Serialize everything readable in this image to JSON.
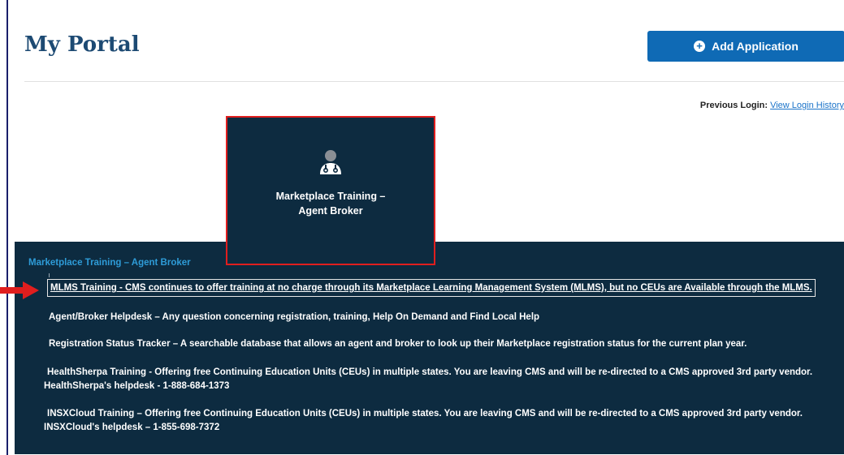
{
  "header": {
    "title": "My Portal",
    "add_application_label": "Add Application",
    "previous_login_label": "Previous Login:",
    "view_login_history": "View Login History"
  },
  "tile": {
    "label_line1": "Marketplace Training –",
    "label_line2": "Agent Broker",
    "icon": "person-stethoscope-icon"
  },
  "panel": {
    "heading": "Marketplace Training – Agent Broker",
    "items": [
      {
        "text": "MLMS Training - CMS continues to offer training at no charge through its Marketplace Learning Management System (MLMS), but no CEUs are Available through the MLMS."
      },
      {
        "text": "Agent/Broker Helpdesk – Any question concerning registration, training, Help On Demand and Find Local Help"
      },
      {
        "text": "Registration Status Tracker – A searchable database that allows an agent and broker to look up their Marketplace registration status for the current plan year."
      },
      {
        "text": "HealthSherpa Training - Offering free Continuing Education Units (CEUs) in multiple states. You are leaving CMS and will be re-directed to a CMS approved 3rd party vendor.",
        "sub": "HealthSherpa's helpdesk - 1-888-684-1373"
      },
      {
        "text": "INSXCloud Training – Offering free Continuing Education Units (CEUs) in multiple states. You are leaving CMS and will be re-directed to a CMS approved 3rd party vendor.",
        "sub": "INSXCloud's helpdesk – 1-855-698-7372"
      }
    ]
  },
  "colors": {
    "title": "#1d4a73",
    "button": "#0f6ab5",
    "panel_bg": "#0d2b40",
    "heading": "#2e9cd8",
    "highlight_outline": "#e01e1e"
  }
}
